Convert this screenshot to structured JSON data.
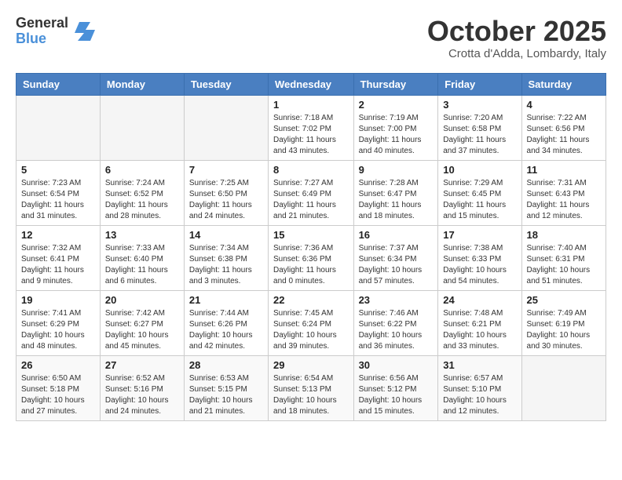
{
  "logo": {
    "general": "General",
    "blue": "Blue"
  },
  "title": "October 2025",
  "subtitle": "Crotta d'Adda, Lombardy, Italy",
  "days_of_week": [
    "Sunday",
    "Monday",
    "Tuesday",
    "Wednesday",
    "Thursday",
    "Friday",
    "Saturday"
  ],
  "weeks": [
    [
      {
        "day": "",
        "info": ""
      },
      {
        "day": "",
        "info": ""
      },
      {
        "day": "",
        "info": ""
      },
      {
        "day": "1",
        "info": "Sunrise: 7:18 AM\nSunset: 7:02 PM\nDaylight: 11 hours\nand 43 minutes."
      },
      {
        "day": "2",
        "info": "Sunrise: 7:19 AM\nSunset: 7:00 PM\nDaylight: 11 hours\nand 40 minutes."
      },
      {
        "day": "3",
        "info": "Sunrise: 7:20 AM\nSunset: 6:58 PM\nDaylight: 11 hours\nand 37 minutes."
      },
      {
        "day": "4",
        "info": "Sunrise: 7:22 AM\nSunset: 6:56 PM\nDaylight: 11 hours\nand 34 minutes."
      }
    ],
    [
      {
        "day": "5",
        "info": "Sunrise: 7:23 AM\nSunset: 6:54 PM\nDaylight: 11 hours\nand 31 minutes."
      },
      {
        "day": "6",
        "info": "Sunrise: 7:24 AM\nSunset: 6:52 PM\nDaylight: 11 hours\nand 28 minutes."
      },
      {
        "day": "7",
        "info": "Sunrise: 7:25 AM\nSunset: 6:50 PM\nDaylight: 11 hours\nand 24 minutes."
      },
      {
        "day": "8",
        "info": "Sunrise: 7:27 AM\nSunset: 6:49 PM\nDaylight: 11 hours\nand 21 minutes."
      },
      {
        "day": "9",
        "info": "Sunrise: 7:28 AM\nSunset: 6:47 PM\nDaylight: 11 hours\nand 18 minutes."
      },
      {
        "day": "10",
        "info": "Sunrise: 7:29 AM\nSunset: 6:45 PM\nDaylight: 11 hours\nand 15 minutes."
      },
      {
        "day": "11",
        "info": "Sunrise: 7:31 AM\nSunset: 6:43 PM\nDaylight: 11 hours\nand 12 minutes."
      }
    ],
    [
      {
        "day": "12",
        "info": "Sunrise: 7:32 AM\nSunset: 6:41 PM\nDaylight: 11 hours\nand 9 minutes."
      },
      {
        "day": "13",
        "info": "Sunrise: 7:33 AM\nSunset: 6:40 PM\nDaylight: 11 hours\nand 6 minutes."
      },
      {
        "day": "14",
        "info": "Sunrise: 7:34 AM\nSunset: 6:38 PM\nDaylight: 11 hours\nand 3 minutes."
      },
      {
        "day": "15",
        "info": "Sunrise: 7:36 AM\nSunset: 6:36 PM\nDaylight: 11 hours\nand 0 minutes."
      },
      {
        "day": "16",
        "info": "Sunrise: 7:37 AM\nSunset: 6:34 PM\nDaylight: 10 hours\nand 57 minutes."
      },
      {
        "day": "17",
        "info": "Sunrise: 7:38 AM\nSunset: 6:33 PM\nDaylight: 10 hours\nand 54 minutes."
      },
      {
        "day": "18",
        "info": "Sunrise: 7:40 AM\nSunset: 6:31 PM\nDaylight: 10 hours\nand 51 minutes."
      }
    ],
    [
      {
        "day": "19",
        "info": "Sunrise: 7:41 AM\nSunset: 6:29 PM\nDaylight: 10 hours\nand 48 minutes."
      },
      {
        "day": "20",
        "info": "Sunrise: 7:42 AM\nSunset: 6:27 PM\nDaylight: 10 hours\nand 45 minutes."
      },
      {
        "day": "21",
        "info": "Sunrise: 7:44 AM\nSunset: 6:26 PM\nDaylight: 10 hours\nand 42 minutes."
      },
      {
        "day": "22",
        "info": "Sunrise: 7:45 AM\nSunset: 6:24 PM\nDaylight: 10 hours\nand 39 minutes."
      },
      {
        "day": "23",
        "info": "Sunrise: 7:46 AM\nSunset: 6:22 PM\nDaylight: 10 hours\nand 36 minutes."
      },
      {
        "day": "24",
        "info": "Sunrise: 7:48 AM\nSunset: 6:21 PM\nDaylight: 10 hours\nand 33 minutes."
      },
      {
        "day": "25",
        "info": "Sunrise: 7:49 AM\nSunset: 6:19 PM\nDaylight: 10 hours\nand 30 minutes."
      }
    ],
    [
      {
        "day": "26",
        "info": "Sunrise: 6:50 AM\nSunset: 5:18 PM\nDaylight: 10 hours\nand 27 minutes."
      },
      {
        "day": "27",
        "info": "Sunrise: 6:52 AM\nSunset: 5:16 PM\nDaylight: 10 hours\nand 24 minutes."
      },
      {
        "day": "28",
        "info": "Sunrise: 6:53 AM\nSunset: 5:15 PM\nDaylight: 10 hours\nand 21 minutes."
      },
      {
        "day": "29",
        "info": "Sunrise: 6:54 AM\nSunset: 5:13 PM\nDaylight: 10 hours\nand 18 minutes."
      },
      {
        "day": "30",
        "info": "Sunrise: 6:56 AM\nSunset: 5:12 PM\nDaylight: 10 hours\nand 15 minutes."
      },
      {
        "day": "31",
        "info": "Sunrise: 6:57 AM\nSunset: 5:10 PM\nDaylight: 10 hours\nand 12 minutes."
      },
      {
        "day": "",
        "info": ""
      }
    ]
  ]
}
